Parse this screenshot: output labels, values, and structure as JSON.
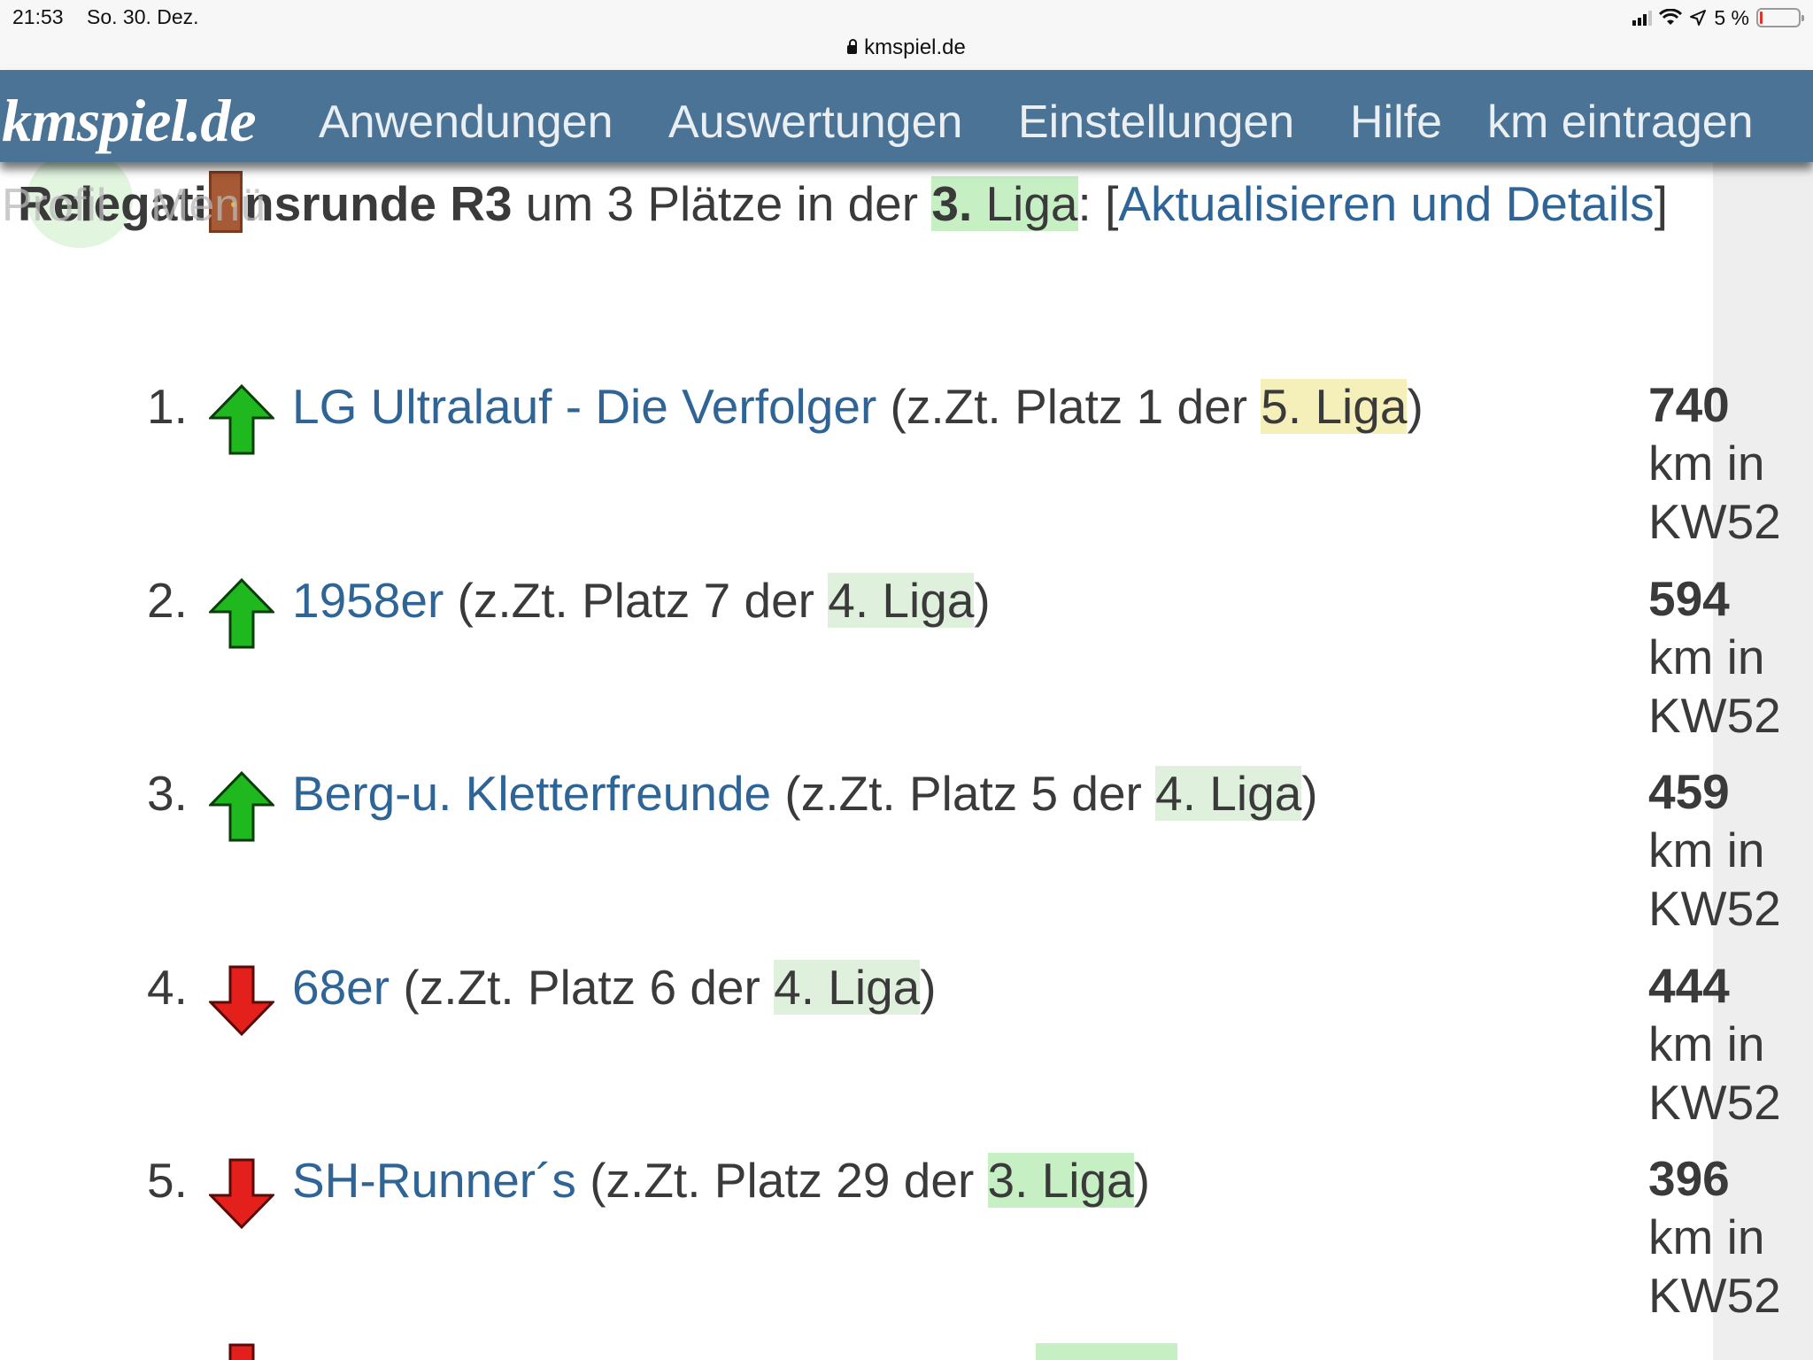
{
  "status_bar": {
    "time": "21:53",
    "date": "So. 30. Dez.",
    "url": "kmspiel.de",
    "battery_text": "5 %"
  },
  "nav": {
    "brand": "kmspiel.de",
    "items": [
      "Anwendungen",
      "Auswertungen",
      "Einstellungen",
      "Hilfe",
      "km eintragen"
    ]
  },
  "ghost": {
    "profile": "Profil",
    "menu": "Menü"
  },
  "header": {
    "title_part1": "Relegati",
    "title_part2": "nsrunde R3",
    "text_mid": " um 3 Plätze in der ",
    "liga_bold": "3.",
    "liga_rest": " Liga",
    "colon": ": [",
    "link": "Aktualisieren und Details",
    "close": "]"
  },
  "ranking": [
    {
      "rank": "1.",
      "direction": "up",
      "team": "LG Ultralauf - Die Verfolger",
      "pre": " (z.Zt. Platz 1 der ",
      "liga": "5. Liga",
      "liga_color": "#f5efba",
      "post": ")",
      "km": "740",
      "unit": "km in",
      "week": "KW52"
    },
    {
      "rank": "2.",
      "direction": "up",
      "team": "1958er",
      "pre": " (z.Zt. Platz 7 der ",
      "liga": "4. Liga",
      "liga_color": "#dff0dd",
      "post": ")",
      "km": "594",
      "unit": "km in",
      "week": "KW52"
    },
    {
      "rank": "3.",
      "direction": "up",
      "team": "Berg-u. Kletterfreunde",
      "pre": " (z.Zt. Platz 5 der ",
      "liga": "4. Liga",
      "liga_color": "#dff0dd",
      "post": ")",
      "km": "459",
      "unit": "km in",
      "week": "KW52"
    },
    {
      "rank": "4.",
      "direction": "down",
      "team": "68er",
      "pre": " (z.Zt. Platz 6 der ",
      "liga": "4. Liga",
      "liga_color": "#dff0dd",
      "post": ")",
      "km": "444",
      "unit": "km in",
      "week": "KW52"
    },
    {
      "rank": "5.",
      "direction": "down",
      "team": "SH-Runner´s",
      "pre": " (z.Zt. Platz 29 der ",
      "liga": "3. Liga",
      "liga_color": "#c6efc4",
      "post": ")",
      "km": "396",
      "unit": "km in",
      "week": "KW52"
    }
  ],
  "colors": {
    "nav_bg": "#4a7395",
    "link": "#2f6497",
    "arrow_up": "#1fb81f",
    "arrow_down": "#e3201b"
  }
}
